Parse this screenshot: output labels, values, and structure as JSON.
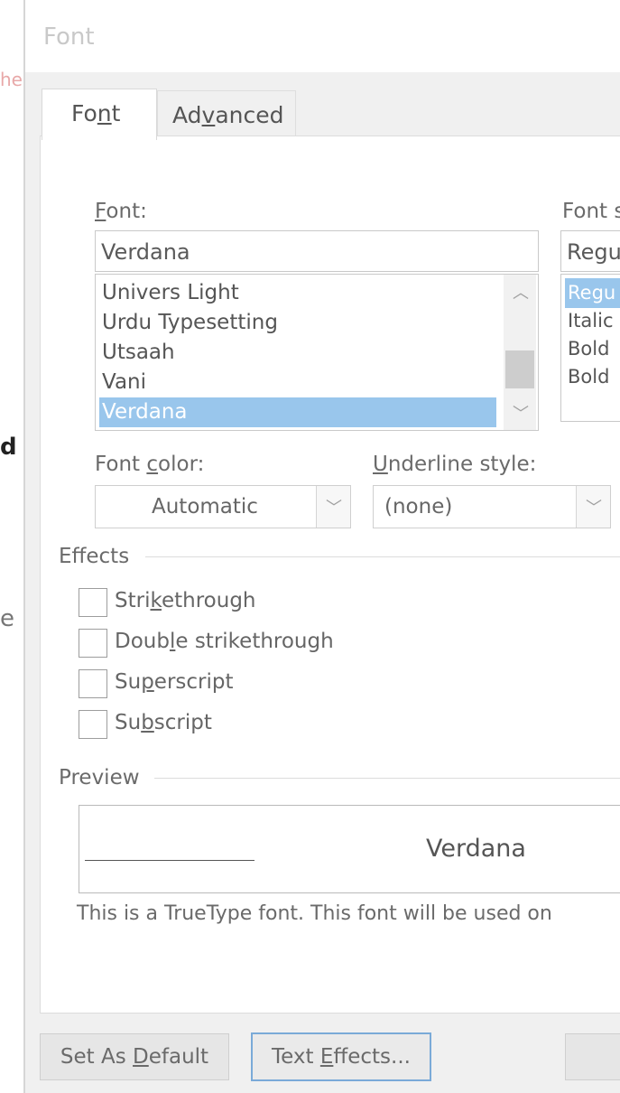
{
  "background": {
    "edge_letters": [
      "he",
      "d",
      "e"
    ]
  },
  "dialog": {
    "title": "Font"
  },
  "tabs": [
    {
      "label_pre": "Fo",
      "label_u": "n",
      "label_post": "t",
      "active": true
    },
    {
      "label_pre": "Ad",
      "label_u": "v",
      "label_post": "anced",
      "active": false
    }
  ],
  "font": {
    "label_u": "F",
    "label_rest": "ont:",
    "value": "Verdana",
    "list": [
      "Univers Light",
      "Urdu Typesetting",
      "Utsaah",
      "Vani",
      "Verdana"
    ],
    "selected_index": 4
  },
  "font_style": {
    "label": "Font s",
    "value": "Regu",
    "list": [
      "Regu",
      "Italic",
      "Bold",
      "Bold"
    ],
    "selected_index": 0
  },
  "font_color": {
    "label_pre": "Font ",
    "label_u": "c",
    "label_post": "olor:",
    "value": "Automatic"
  },
  "underline_style": {
    "label_u": "U",
    "label_rest": "nderline style:",
    "value": "(none)"
  },
  "effects": {
    "heading": "Effects",
    "items": [
      {
        "pre": "Stri",
        "u": "k",
        "post": "ethrough",
        "checked": false
      },
      {
        "pre": "Doub",
        "u": "l",
        "post": "e strikethrough",
        "checked": false
      },
      {
        "pre": "Su",
        "u": "p",
        "post": "erscript",
        "checked": false
      },
      {
        "pre": "Su",
        "u": "b",
        "post": "script",
        "checked": false
      }
    ]
  },
  "preview": {
    "heading": "Preview",
    "sample": "Verdana",
    "note": "This is a TrueType font. This font will be used on"
  },
  "buttons": {
    "set_default": {
      "pre": "Set As ",
      "u": "D",
      "post": "efault"
    },
    "text_effects": {
      "pre": "Text ",
      "u": "E",
      "post": "ffects..."
    }
  },
  "colors": {
    "selection": "#99c6ec",
    "focus_border": "#7aaad8",
    "dialog_bg": "#f0f0f0"
  }
}
